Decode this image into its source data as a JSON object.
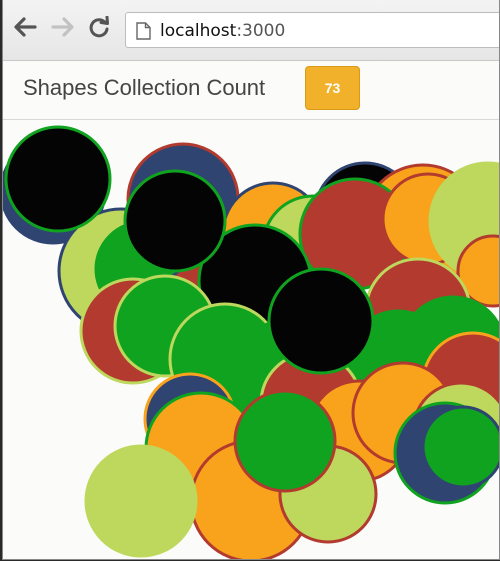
{
  "browser": {
    "url_host": "localhost",
    "url_port": ":3000"
  },
  "header": {
    "title": "Shapes Collection Count",
    "count": "73"
  },
  "icons": {
    "back": "back-arrow-icon",
    "forward": "forward-arrow-icon",
    "reload": "reload-icon",
    "page": "page-icon"
  },
  "colors": {
    "navy": "#2f4470",
    "black": "#040404",
    "green": "#0fa320",
    "red": "#b33a2e",
    "orange": "#f8a31b",
    "lime": "#bdd85c",
    "badge": "#f1b12a"
  }
}
